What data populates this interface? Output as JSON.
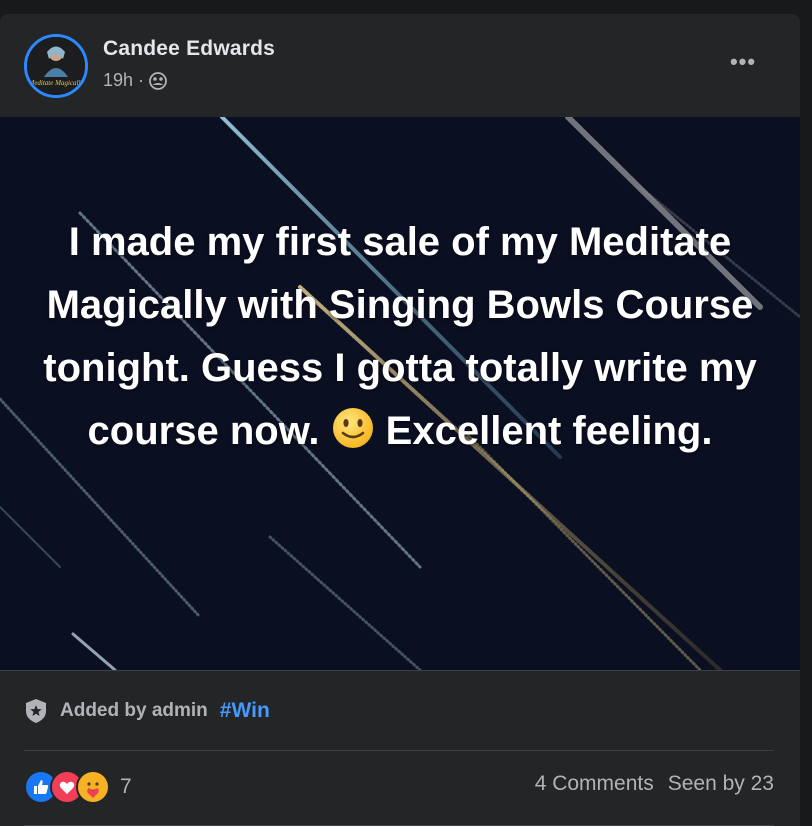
{
  "post": {
    "author": "Candee Edwards",
    "time": "19h",
    "separator": "·",
    "audience_icon": "group-icon",
    "more_label": "•••",
    "text_parts": [
      "I made my first sale of my Meditate Magically with Singing Bowls Course tonight. Guess I gotta totally write my course now. ",
      " Excellent feeling."
    ],
    "emoji": "slightly-smiling-face",
    "avatar_text": "Meditate Magically"
  },
  "footer": {
    "admin_label": "Added by admin",
    "hashtag": "#Win",
    "reaction_icons": [
      "like-icon",
      "love-icon",
      "care-icon"
    ],
    "reaction_count": "7",
    "comments": "4 Comments",
    "seen_by": "Seen by 23"
  },
  "colors": {
    "background": "#18191a",
    "card": "#242526",
    "accent": "#2d88ff",
    "hashtag": "#4599ff",
    "secondary_text": "#b0b3b8",
    "post_bg": "#0b0f22"
  }
}
